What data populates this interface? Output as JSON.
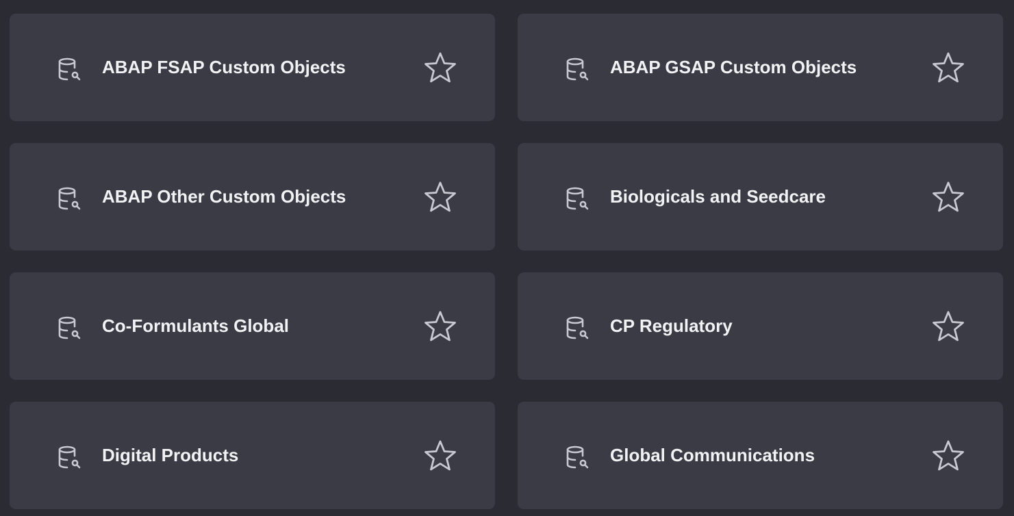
{
  "colors": {
    "background": "#2b2b33",
    "card": "#3b3b46",
    "text": "#f2f2f5",
    "icon": "#c9c9d1"
  },
  "cards": [
    {
      "label": "ABAP FSAP Custom Objects",
      "icon": "database-search-icon",
      "starred": false
    },
    {
      "label": "ABAP GSAP Custom Objects",
      "icon": "database-search-icon",
      "starred": false
    },
    {
      "label": "ABAP Other Custom Objects",
      "icon": "database-search-icon",
      "starred": false
    },
    {
      "label": "Biologicals and Seedcare",
      "icon": "database-search-icon",
      "starred": false
    },
    {
      "label": "Co-Formulants Global",
      "icon": "database-search-icon",
      "starred": false
    },
    {
      "label": "CP Regulatory",
      "icon": "database-search-icon",
      "starred": false
    },
    {
      "label": "Digital Products",
      "icon": "database-search-icon",
      "starred": false
    },
    {
      "label": "Global Communications",
      "icon": "database-search-icon",
      "starred": false
    }
  ]
}
